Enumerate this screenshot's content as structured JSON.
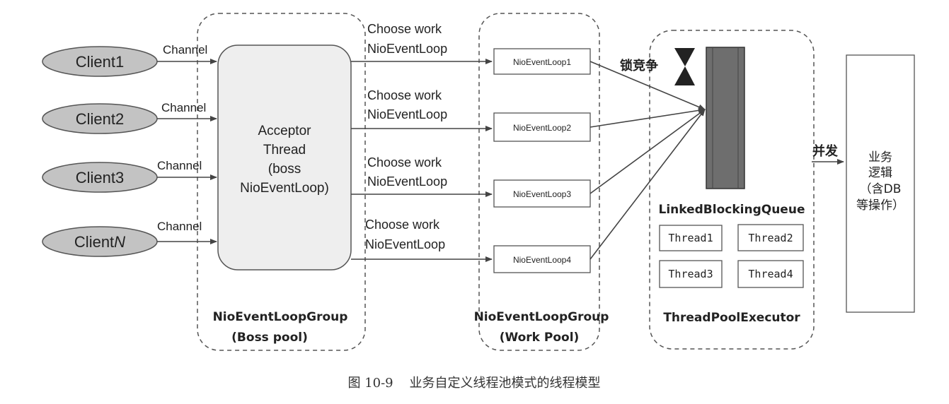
{
  "clients": [
    "Client1",
    "Client2",
    "Client3",
    "ClientN"
  ],
  "channel_label": "Channel",
  "acceptor": {
    "line1": "Acceptor",
    "line2": "Thread",
    "line3": "(boss",
    "line4": "NioEventLoop)"
  },
  "choose": {
    "line1": "Choose work",
    "line2": "NioEventLoop"
  },
  "event_loops": [
    "NioEventLoop1",
    "NioEventLoop2",
    "NioEventLoop3",
    "NioEventLoop4"
  ],
  "boss_group": {
    "line1": "NioEventLoopGroup",
    "line2": "(Boss pool)"
  },
  "work_group": {
    "line1": "NioEventLoopGroup",
    "line2": "(Work Pool)"
  },
  "lock_label": "锁竞争",
  "queue_label": "LinkedBlockingQueue",
  "threads": [
    "Thread1",
    "Thread2",
    "Thread3",
    "Thread4"
  ],
  "executor_label": "ThreadPoolExecutor",
  "concurrent_label": "并发",
  "business": {
    "line1": "业务",
    "line2": "逻辑",
    "line3": "（含DB",
    "line4": "等操作）"
  },
  "caption": "图 10-9    业务自定义线程池模式的线程模型",
  "colors": {
    "client_fill": "#c3c3c3",
    "acceptor_fill": "#eeeeee",
    "queue_fill": "#6e6e6e",
    "stroke": "#444444"
  }
}
